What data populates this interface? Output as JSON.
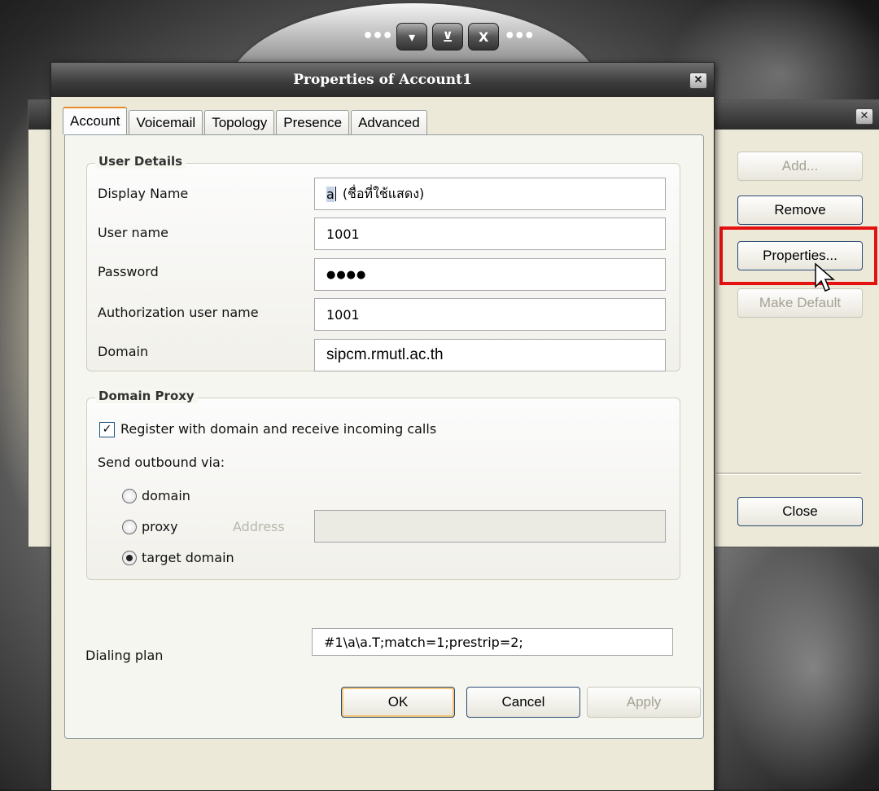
{
  "window_title": "Properties of Account1",
  "tabs": [
    "Account",
    "Voicemail",
    "Topology",
    "Presence",
    "Advanced"
  ],
  "user_details": {
    "title": "User Details",
    "display_name_label": "Display Name",
    "display_name_value": "a",
    "display_name_note": "(ชื่อที่ใช้แสดง)",
    "user_name_label": "User name",
    "user_name_value": "1001",
    "password_label": "Password",
    "password_value": "●●●●",
    "auth_user_label": "Authorization user name",
    "auth_user_value": "1001",
    "domain_label": "Domain",
    "domain_value": "sipcm.rmutl.ac.th"
  },
  "domain_proxy": {
    "title": "Domain Proxy",
    "register_label": "Register with domain and receive incoming calls",
    "register_checked": true,
    "send_outbound_label": "Send outbound via:",
    "radio_domain": "domain",
    "radio_proxy": "proxy",
    "address_label": "Address",
    "radio_target": "target domain",
    "selected": "target domain"
  },
  "dialing_plan": {
    "label": "Dialing plan",
    "value": "#1\\a\\a.T;match=1;prestrip=2;"
  },
  "buttons": {
    "ok": "OK",
    "cancel": "Cancel",
    "apply": "Apply"
  },
  "side_buttons": {
    "add": "Add...",
    "remove": "Remove",
    "properties": "Properties...",
    "make_default": "Make Default",
    "close": "Close"
  },
  "topbar_buttons": [
    "▾",
    "⊻",
    "X"
  ],
  "colors": {
    "highlight": "#e51010",
    "tab_accent": "#e68b2c",
    "button_border": "#2b4a73"
  }
}
